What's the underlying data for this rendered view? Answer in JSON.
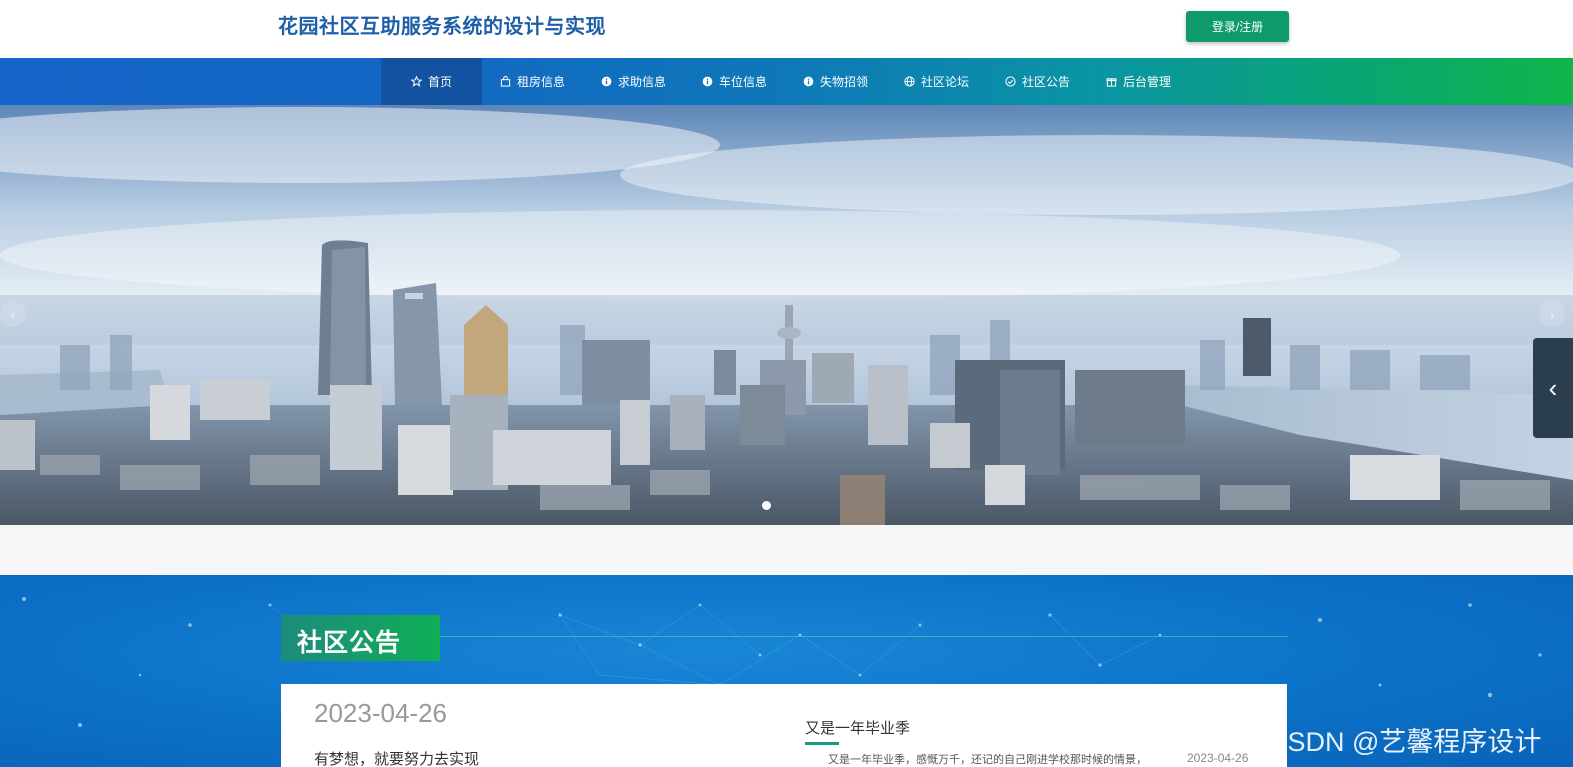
{
  "header": {
    "site_title": "花园社区互助服务系统的设计与实现",
    "login_label": "登录/注册"
  },
  "nav": {
    "items": [
      {
        "label": "首页",
        "icon": "star-icon",
        "active": true
      },
      {
        "label": "租房信息",
        "icon": "bag-icon",
        "active": false
      },
      {
        "label": "求助信息",
        "icon": "info-circle-icon",
        "active": false
      },
      {
        "label": "车位信息",
        "icon": "info-circle-icon",
        "active": false
      },
      {
        "label": "失物招领",
        "icon": "info-circle-icon",
        "active": false
      },
      {
        "label": "社区论坛",
        "icon": "globe-icon",
        "active": false
      },
      {
        "label": "社区公告",
        "icon": "check-circle-icon",
        "active": false
      },
      {
        "label": "后台管理",
        "icon": "gift-icon",
        "active": false
      }
    ]
  },
  "banner": {
    "prev_glyph": "‹",
    "next_glyph": "›",
    "side_tab_glyph": "‹",
    "slide_count": 1,
    "active_slide": 1
  },
  "notice": {
    "section_title": "社区公告",
    "featured": {
      "date": "2023-04-26",
      "text": "有梦想，就要努力去实现"
    },
    "news": [
      {
        "title": "又是一年毕业季",
        "summary": "又是一年毕业季，感慨万千，还记的自己刚进学校那时候的情景，",
        "date": "2023-04-26"
      }
    ]
  },
  "watermark": "CSDN @艺馨程序设计",
  "colors": {
    "brand_blue": "#1e5fa8",
    "login_green": "#0f9a6a",
    "nav_active": "#1352a0",
    "section_green": "#0fae55"
  }
}
